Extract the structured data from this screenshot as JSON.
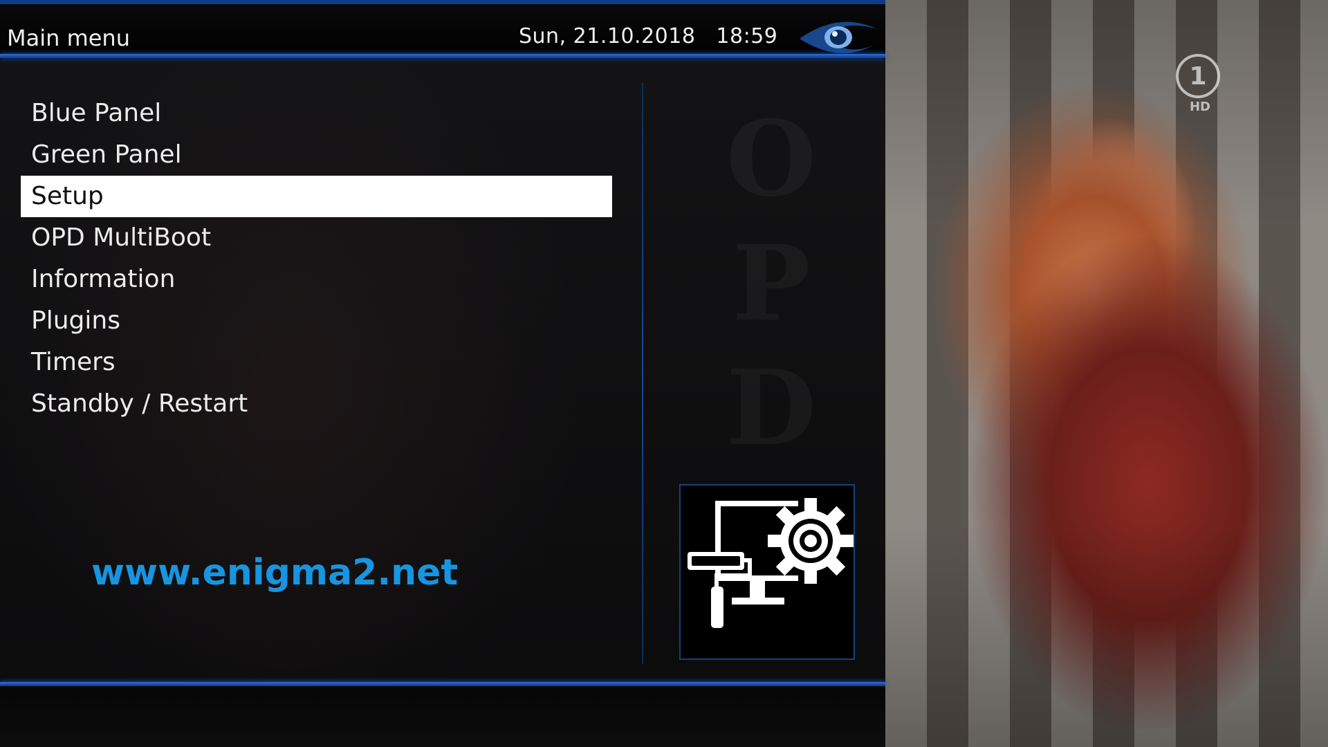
{
  "header": {
    "title": "Main menu",
    "date": "Sun, 21.10.2018",
    "time": "18:59"
  },
  "menu": {
    "items": [
      {
        "label": "Blue Panel",
        "selected": false
      },
      {
        "label": "Green Panel",
        "selected": false
      },
      {
        "label": "Setup",
        "selected": true
      },
      {
        "label": "OPD MultiBoot",
        "selected": false
      },
      {
        "label": "Information",
        "selected": false
      },
      {
        "label": "Plugins",
        "selected": false
      },
      {
        "label": "Timers",
        "selected": false
      },
      {
        "label": "Standby / Restart",
        "selected": false
      }
    ]
  },
  "website": "www.enigma2.net",
  "preview_icon": "setup-paint-gear-icon",
  "watermark": [
    "O",
    "P",
    "D"
  ],
  "channel_logo": {
    "number": "1",
    "badge": "HD"
  },
  "colors": {
    "accent_blue": "#2d6fd6",
    "website_blue": "#1895e0",
    "selection_bg": "#ffffff"
  }
}
